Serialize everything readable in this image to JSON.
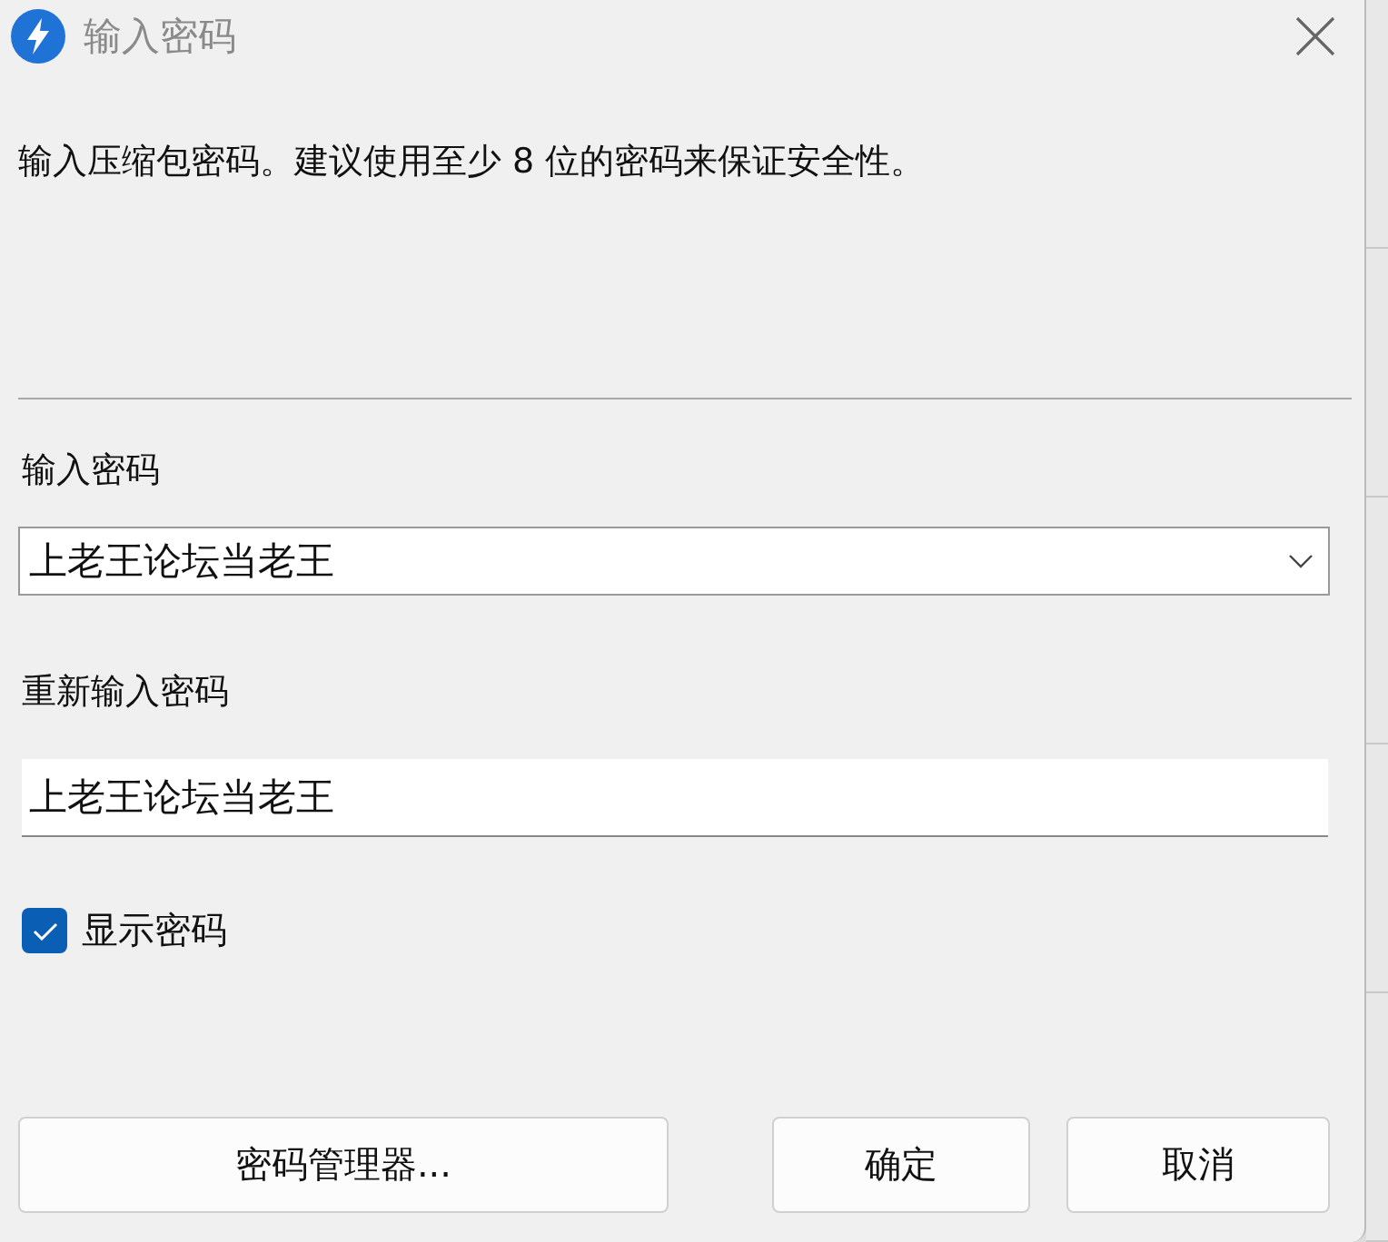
{
  "window": {
    "title": "输入密码"
  },
  "description": "输入压缩包密码。建议使用至少 8 位的密码来保证安全性。",
  "password": {
    "label": "输入密码",
    "value": "上老王论坛当老王"
  },
  "confirm": {
    "label": "重新输入密码",
    "value": "上老王论坛当老王"
  },
  "show_password": {
    "label": "显示密码",
    "checked": true
  },
  "buttons": [
    {
      "label": "密码管理器..."
    },
    {
      "label": "确定"
    },
    {
      "label": "取消"
    }
  ]
}
